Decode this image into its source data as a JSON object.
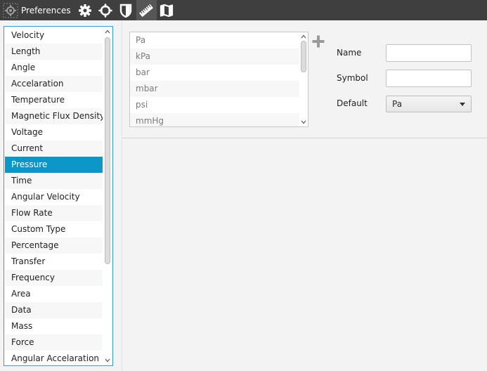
{
  "toolbar": {
    "title": "Preferences",
    "icons": [
      "gear-logo-icon",
      "settings-gear-icon",
      "crosshair-icon",
      "shield-icon",
      "ruler-icon",
      "map-icon"
    ],
    "active_tab": "ruler-icon",
    "background": "#3f3f3f"
  },
  "unit_types": {
    "items": [
      "Velocity",
      "Length",
      "Angle",
      "Accelaration",
      "Temperature",
      "Magnetic Flux Density",
      "Voltage",
      "Current",
      "Pressure",
      "Time",
      "Angular Velocity",
      "Flow Rate",
      "Custom Type",
      "Percentage",
      "Transfer",
      "Frequency",
      "Area",
      "Data",
      "Mass",
      "Force",
      "Angular Accelaration"
    ],
    "selected": "Pressure",
    "selected_color": "#0b96c8",
    "border_color": "#2aa1d1"
  },
  "units": {
    "items": [
      "Pa",
      "kPa",
      "bar",
      "mbar",
      "psi",
      "mmHg"
    ]
  },
  "form": {
    "name_label": "Name",
    "name_value": "",
    "symbol_label": "Symbol",
    "symbol_value": "",
    "default_label": "Default",
    "default_value": "Pa"
  }
}
